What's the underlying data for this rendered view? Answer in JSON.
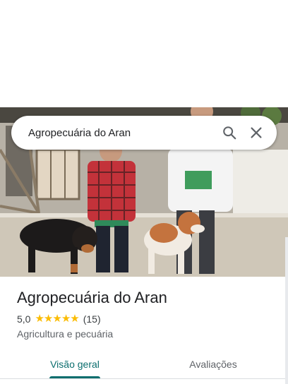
{
  "search": {
    "query": "Agropecuária do Aran",
    "search_icon": "search-icon",
    "close_icon": "close-icon"
  },
  "hero": {
    "image": "photo-two-boys-with-dogs"
  },
  "place": {
    "name": "Agropecuária do Aran",
    "rating": "5,0",
    "stars": [
      "★",
      "★",
      "★",
      "★",
      "★"
    ],
    "review_count": "(15)",
    "category": "Agricultura e pecuária"
  },
  "tabs": [
    {
      "label": "Visão geral",
      "active": true
    },
    {
      "label": "Avaliações",
      "active": false
    }
  ],
  "colors": {
    "accent": "#0b6e6e",
    "star": "#fbbc04",
    "title": "#202124",
    "secondary": "#5f6368"
  }
}
